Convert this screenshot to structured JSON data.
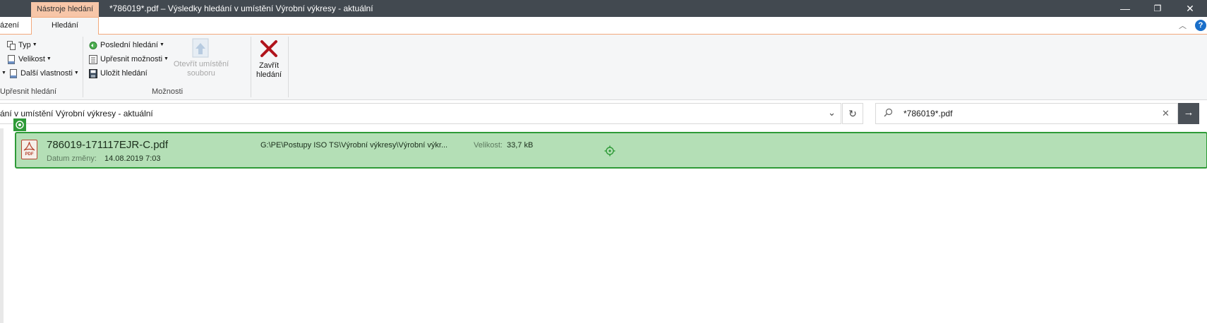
{
  "window": {
    "context_tab": "Nástroje hledání",
    "title": "*786019*.pdf – Výsledky hledání v umístění Výrobní výkresy - aktuální",
    "minimize": "—",
    "maximize": "❐",
    "close": "✕"
  },
  "ribbon_tabs": {
    "partial": "ázení",
    "active": "Hledání"
  },
  "ribbon": {
    "refine": {
      "type_label": "Typ",
      "size_label": "Velikost",
      "more_props_label": "Další vlastnosti",
      "group_label": "Upřesnit hledání"
    },
    "options": {
      "recent_label": "Poslední hledání",
      "advanced_label": "Upřesnit možnosti",
      "save_label": "Uložit hledání",
      "open_location_line1": "Otevřít umístění",
      "open_location_line2": "souboru",
      "group_label": "Možnosti"
    },
    "close": {
      "line1": "Zavřít",
      "line2": "hledání"
    }
  },
  "address": {
    "text": "ání v umístění Výrobní výkresy - aktuální"
  },
  "search": {
    "value": "*786019*.pdf"
  },
  "result": {
    "filename": "786019-171117EJR-C.pdf",
    "date_label": "Datum změny:",
    "date_value": "14.08.2019 7:03",
    "path": "G:\\PE\\Postupy ISO TS\\Výrobní výkresy\\Výrobní výkr...",
    "size_label": "Velikost:",
    "size_value": "33,7 kB",
    "file_icon_text": "PDF"
  },
  "colors": {
    "titlebar": "#424950",
    "context_tab": "#f7c6a8",
    "result_fill": "#b4dfb6",
    "result_border": "#2e9a37",
    "close_x": "#b0141c",
    "help": "#1a6fc9"
  }
}
